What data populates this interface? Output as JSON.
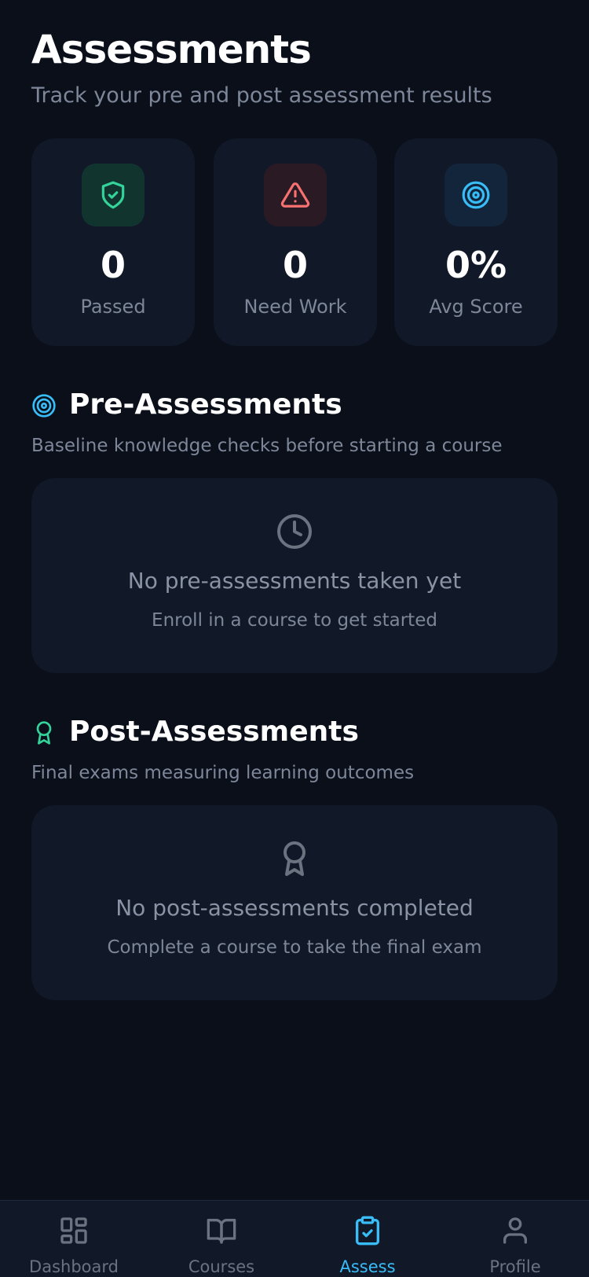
{
  "header": {
    "title": "Assessments",
    "subtitle": "Track your pre and post assessment results"
  },
  "stats": [
    {
      "icon": "shield-check-icon",
      "value": "0",
      "label": "Passed",
      "color": "#34d399"
    },
    {
      "icon": "alert-triangle-icon",
      "value": "0",
      "label": "Need Work",
      "color": "#f87171"
    },
    {
      "icon": "target-icon",
      "value": "0%",
      "label": "Avg Score",
      "color": "#38bdf8"
    }
  ],
  "pre": {
    "icon": "target-icon",
    "title": "Pre-Assessments",
    "description": "Baseline knowledge checks before starting a course",
    "empty_icon": "clock-icon",
    "empty_title": "No pre-assessments taken yet",
    "empty_subtitle": "Enroll in a course to get started"
  },
  "post": {
    "icon": "award-icon",
    "title": "Post-Assessments",
    "description": "Final exams measuring learning outcomes",
    "empty_icon": "award-icon",
    "empty_title": "No post-assessments completed",
    "empty_subtitle": "Complete a course to take the final exam"
  },
  "nav": {
    "items": [
      {
        "label": "Dashboard",
        "icon": "dashboard-icon",
        "active": false
      },
      {
        "label": "Courses",
        "icon": "book-icon",
        "active": false
      },
      {
        "label": "Assess",
        "icon": "clipboard-check-icon",
        "active": true
      },
      {
        "label": "Profile",
        "icon": "user-icon",
        "active": false
      }
    ]
  },
  "colors": {
    "background": "#0a0f1a",
    "card": "#111827",
    "accent": "#38bdf8",
    "success": "#34d399",
    "danger": "#f87171",
    "muted": "#7d8799"
  }
}
